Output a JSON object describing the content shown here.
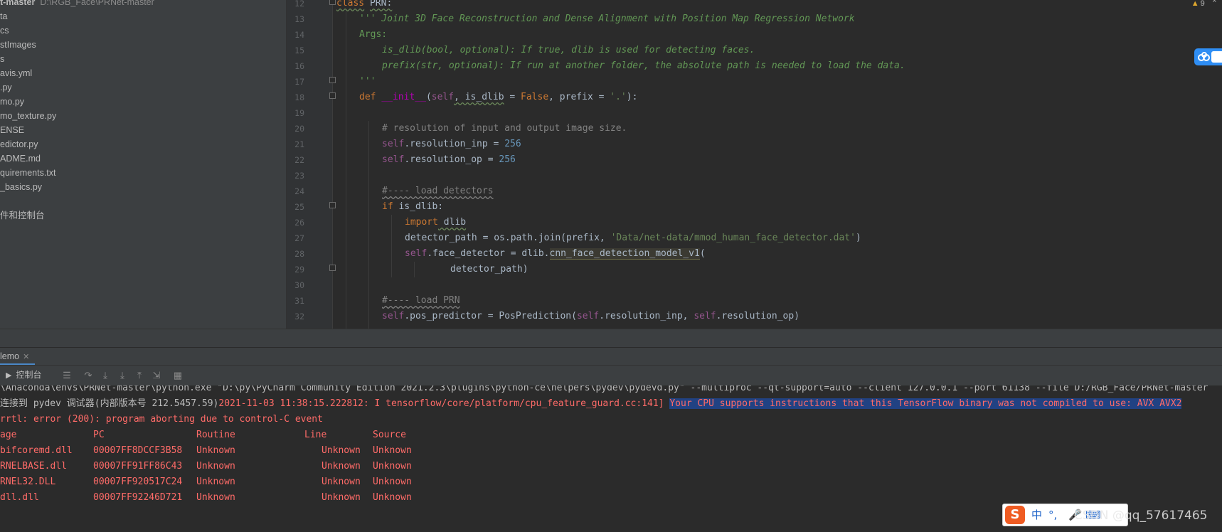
{
  "project_tree": {
    "root_name": "t-master",
    "root_path": "D:\\RGB_Face\\PRNet-master",
    "items": [
      "ta",
      "cs",
      "stImages",
      "s",
      "avis.yml",
      ".py",
      "mo.py",
      "mo_texture.py",
      "ENSE",
      "edictor.py",
      "ADME.md",
      "quirements.txt",
      "_basics.py",
      "",
      "件和控制台"
    ]
  },
  "editor": {
    "warning_count": "9",
    "lines": [
      {
        "n": "12"
      },
      {
        "n": "13"
      },
      {
        "n": "14"
      },
      {
        "n": "15"
      },
      {
        "n": "16"
      },
      {
        "n": "17"
      },
      {
        "n": "18"
      },
      {
        "n": "19"
      },
      {
        "n": "20"
      },
      {
        "n": "21"
      },
      {
        "n": "22"
      },
      {
        "n": "23"
      },
      {
        "n": "24"
      },
      {
        "n": "25"
      },
      {
        "n": "26"
      },
      {
        "n": "27"
      },
      {
        "n": "28"
      },
      {
        "n": "29"
      },
      {
        "n": "30"
      },
      {
        "n": "31"
      },
      {
        "n": "32"
      }
    ],
    "code": {
      "l12_kw": "class",
      "l12_name": "PRN:",
      "l13": "''' Joint 3D Face Reconstruction and Dense Alignment with Position Map Regression Network",
      "l14": "Args:",
      "l15": "is_dlib(bool, optional): If true, dlib is used for detecting faces.",
      "l16": "prefix(str, optional): If run at another folder, the absolute path is needed to load the data.",
      "l17": "'''",
      "l18_def": "def",
      "l18_fn": "__init__",
      "l18_open": "(",
      "l18_self": "self",
      "l18_rest1": ", is_dlib",
      "l18_eq1": " = ",
      "l18_false": "False",
      "l18_rest2": ", prefix",
      "l18_eq2": " = ",
      "l18_str": "'.'",
      "l18_close": "):",
      "l20": "# resolution of input and output image size.",
      "l21_self": "self",
      "l21_rest": ".resolution_inp = ",
      "l21_num": "256",
      "l22_self": "self",
      "l22_rest": ".resolution_op = ",
      "l22_num": "256",
      "l24": "#---- load detectors",
      "l25_kw": "if",
      "l25_rest": " is_dlib:",
      "l26_kw": "import",
      "l26_rest": " dlib",
      "l27_rest": "detector_path = os.path.join(prefix, ",
      "l27_str": "'Data/net-data/mmod_human_face_detector.dat'",
      "l27_close": ")",
      "l28_self": "self",
      "l28_rest": ".face_detector = dlib.",
      "l28_hl": "cnn_face_detection_model_v1",
      "l28_close": "(",
      "l29": "detector_path)",
      "l31": "#---- load PRN",
      "l32_self1": "self",
      "l32_rest1": ".pos_predictor = PosPrediction(",
      "l32_self2": "self",
      "l32_rest2": ".resolution_inp, ",
      "l32_self3": "self",
      "l32_rest3": ".resolution_op)"
    }
  },
  "run_panel": {
    "tab_label": "lemo",
    "console_tab_label": "控制台"
  },
  "console": {
    "line1": "\\Anaconda\\envs\\PRNet-master\\python.exe \"D:\\py\\PyCharm Community Edition 2021.2.3\\plugins\\python-ce\\helpers\\pydev\\pydevd.py\" --multiproc --qt-support=auto --client 127.0.0.1 --port 61138 --file D:/RGB_Face/PRNet-master",
    "line2_white": "连接到 pydev 调试器(内部版本号 212.5457.59)",
    "line2_red": "2021-11-03 11:38:15.222812: I tensorflow/core/platform/cpu_feature_guard.cc:141] ",
    "line2_sel": "Your CPU supports instructions that this TensorFlow binary was not compiled to use: AVX AVX2",
    "line3": "rrtl: error (200): program aborting due to control-C event",
    "header": [
      "age",
      "PC",
      "Routine",
      "Line",
      "Source"
    ],
    "rows": [
      [
        "bifcoremd.dll",
        "00007FF8DCCF3B58",
        "Unknown",
        "Unknown",
        "Unknown"
      ],
      [
        "RNELBASE.dll",
        "00007FF91FF86C43",
        "Unknown",
        "Unknown",
        "Unknown"
      ],
      [
        "RNEL32.DLL",
        "00007FF920517C24",
        "Unknown",
        "Unknown",
        "Unknown"
      ],
      [
        "dll.dll",
        "00007FF92246D721",
        "Unknown",
        "Unknown",
        "Unknown"
      ]
    ]
  },
  "ime": {
    "logo": "S",
    "lang": "中",
    "punct": "°,",
    "mic": "🎤",
    "kbd": "⌨"
  },
  "watermark": "CSDN @qq_57617465"
}
